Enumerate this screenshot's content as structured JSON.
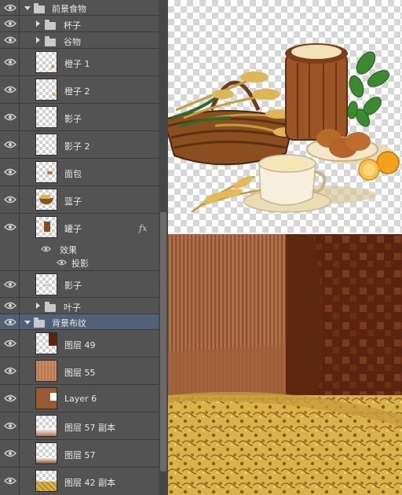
{
  "layers_panel": {
    "rows": [
      {
        "kind": "group",
        "name": "前景食物",
        "expanded": true,
        "indent": 0
      },
      {
        "kind": "group",
        "name": "杯子",
        "expanded": false,
        "indent": 1
      },
      {
        "kind": "group",
        "name": "谷物",
        "expanded": false,
        "indent": 1
      },
      {
        "kind": "layer",
        "name": "橙子 1"
      },
      {
        "kind": "layer",
        "name": "橙子 2"
      },
      {
        "kind": "layer",
        "name": "影子"
      },
      {
        "kind": "layer",
        "name": "影子 2"
      },
      {
        "kind": "layer",
        "name": "面包"
      },
      {
        "kind": "layer",
        "name": "篮子"
      },
      {
        "kind": "layer",
        "name": "罐子",
        "fx": "fx",
        "effects_label": "效果",
        "effect": "投影"
      },
      {
        "kind": "layer",
        "name": "影子"
      },
      {
        "kind": "group",
        "name": "叶子",
        "expanded": false,
        "indent": 1
      },
      {
        "kind": "group",
        "name": "背景布纹",
        "expanded": true,
        "indent": 0,
        "selected": true
      },
      {
        "kind": "layer",
        "name": "图层 49"
      },
      {
        "kind": "layer",
        "name": "图层 55"
      },
      {
        "kind": "layer",
        "name": "Layer 6"
      },
      {
        "kind": "layer",
        "name": "图层 57 副本"
      },
      {
        "kind": "layer",
        "name": "图层 57"
      },
      {
        "kind": "layer",
        "name": "图层 42 副本"
      }
    ]
  },
  "colors": {
    "panel_bg": "#535353",
    "row_border": "#3c3c3c",
    "selected_row": "#4f6178",
    "text": "#e6e6e6",
    "canvas_brown": "#6b3418",
    "floral_gold": "#d9b24a"
  },
  "icons": {
    "visibility": "eye-icon",
    "group": "folder-icon",
    "layer_effects": "fx-icon"
  }
}
